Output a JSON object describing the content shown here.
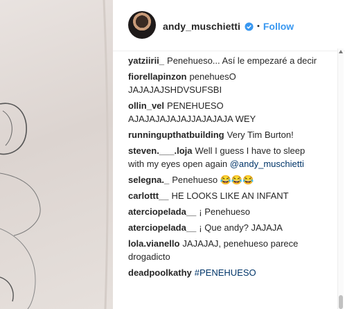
{
  "post": {
    "username": "andy_muschietti",
    "separator": "•",
    "follow_label": "Follow"
  },
  "comments": [
    {
      "user": "yatziirii_",
      "text": "Penehueso... Así le empezaré a decir"
    },
    {
      "user": "fiorellapinzon",
      "text": "penehuesO JAJAJAJSHDVSUFSBI"
    },
    {
      "user": "ollin_vel",
      "text": "PENEHUESO AJAJAJAJAJAJJAJAJAJA WEY"
    },
    {
      "user": "runningupthatbuilding",
      "text": "Very Tim Burton!"
    },
    {
      "user": "steven.___.loja",
      "text": "Well I guess I have to sleep with my eyes open again",
      "mention": "@andy_muschietti"
    },
    {
      "user": "selegna._",
      "text": "Penehueso 😂😂😂"
    },
    {
      "user": "carlottt__",
      "text": "HE LOOKS LIKE AN INFANT"
    },
    {
      "user": "aterciopelada__",
      "text": "¡ Penehueso"
    },
    {
      "user": "aterciopelada__",
      "text": "¡ Que andy? JAJAJA"
    },
    {
      "user": "lola.vianello",
      "text": "JAJAJAJ, penehueso parece drogadicto"
    },
    {
      "user": "deadpoolkathy",
      "text": "#PENEHUESO"
    }
  ],
  "colors": {
    "accent": "#3897f0",
    "text": "#262626",
    "verified": "#3897f0"
  }
}
